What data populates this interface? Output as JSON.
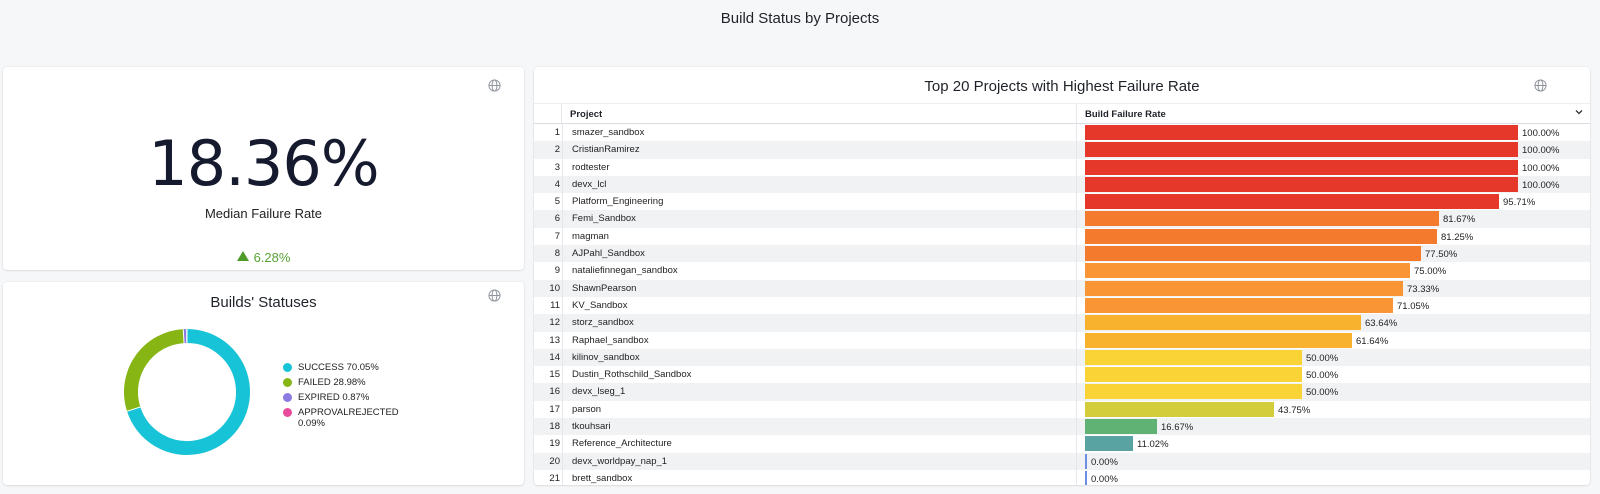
{
  "dashboard": {
    "title": "Build Status by Projects"
  },
  "kpi": {
    "value": "18.36%",
    "label": "Median Failure Rate",
    "delta": "6.28%",
    "delta_color": "#4d9c2a"
  },
  "statuses": {
    "title": "Builds' Statuses",
    "chart_data": {
      "type": "pie",
      "donut": true,
      "categories": [
        "SUCCESS",
        "FAILED",
        "EXPIRED",
        "APPROVALREJECTED"
      ],
      "values": [
        70.05,
        28.98,
        0.87,
        0.09
      ],
      "colors": [
        "#17c3d6",
        "#86b514",
        "#8a7be0",
        "#e84b9c"
      ]
    },
    "legend": [
      {
        "text": "SUCCESS 70.05%",
        "color": "#17c3d6"
      },
      {
        "text": "FAILED 28.98%",
        "color": "#86b514"
      },
      {
        "text": "EXPIRED 0.87%",
        "color": "#8a7be0"
      },
      {
        "text": "APPROVALREJECTED 0.09%",
        "color": "#e84b9c"
      }
    ]
  },
  "table": {
    "title": "Top 20 Projects with Highest Failure Rate",
    "col_project": "Project",
    "col_rate": "Build Failure Rate",
    "chart_data": {
      "type": "bar",
      "orientation": "horizontal",
      "ylim": [
        0,
        100
      ],
      "categories": [
        "smazer_sandbox",
        "CristianRamirez",
        "rodtester",
        "devx_lcl",
        "Platform_Engineering",
        "Femi_Sandbox",
        "magman",
        "AJPahl_Sandbox",
        "nataliefinnegan_sandbox",
        "ShawnPearson",
        "KV_Sandbox",
        "storz_sandbox",
        "Raphael_sandbox",
        "kilinov_sandbox",
        "Dustin_Rothschild_Sandbox",
        "devx_lseg_1",
        "parson",
        "tkouhsari",
        "Reference_Architecture",
        "devx_worldpay_nap_1",
        "brett_sandbox"
      ],
      "values": [
        100.0,
        100.0,
        100.0,
        100.0,
        95.71,
        81.67,
        81.25,
        77.5,
        75.0,
        73.33,
        71.05,
        63.64,
        61.64,
        50.0,
        50.0,
        50.0,
        43.75,
        16.67,
        11.02,
        0.0,
        0.0
      ],
      "labels": [
        "100.00%",
        "100.00%",
        "100.00%",
        "100.00%",
        "95.71%",
        "81.67%",
        "81.25%",
        "77.50%",
        "75.00%",
        "73.33%",
        "71.05%",
        "63.64%",
        "61.64%",
        "50.00%",
        "50.00%",
        "50.00%",
        "43.75%",
        "16.67%",
        "11.02%",
        "0.00%",
        "0.00%"
      ]
    }
  }
}
